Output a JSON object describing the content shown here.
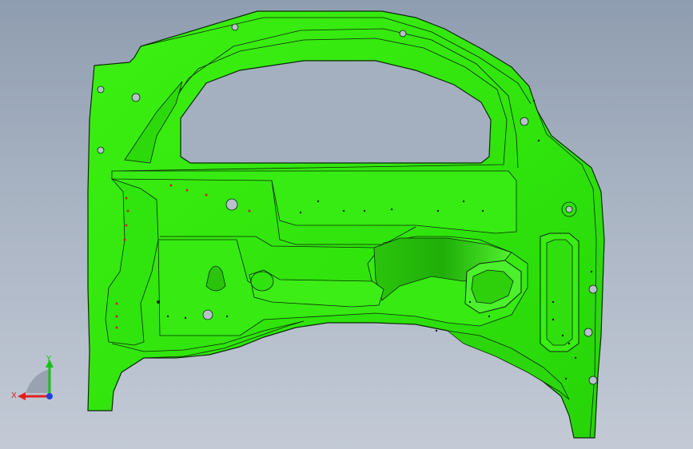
{
  "viewport": {
    "background_top": "#8f9db0",
    "background_bottom": "#c3cad6"
  },
  "model": {
    "part_color": "#33ee10",
    "edge_color": "#0a2a05",
    "hole_color": "#b8c0cc"
  },
  "triad": {
    "x_label": "X",
    "y_label": "Y",
    "x_color": "#e02020",
    "y_color": "#18c018",
    "z_color": "#2040e0"
  }
}
